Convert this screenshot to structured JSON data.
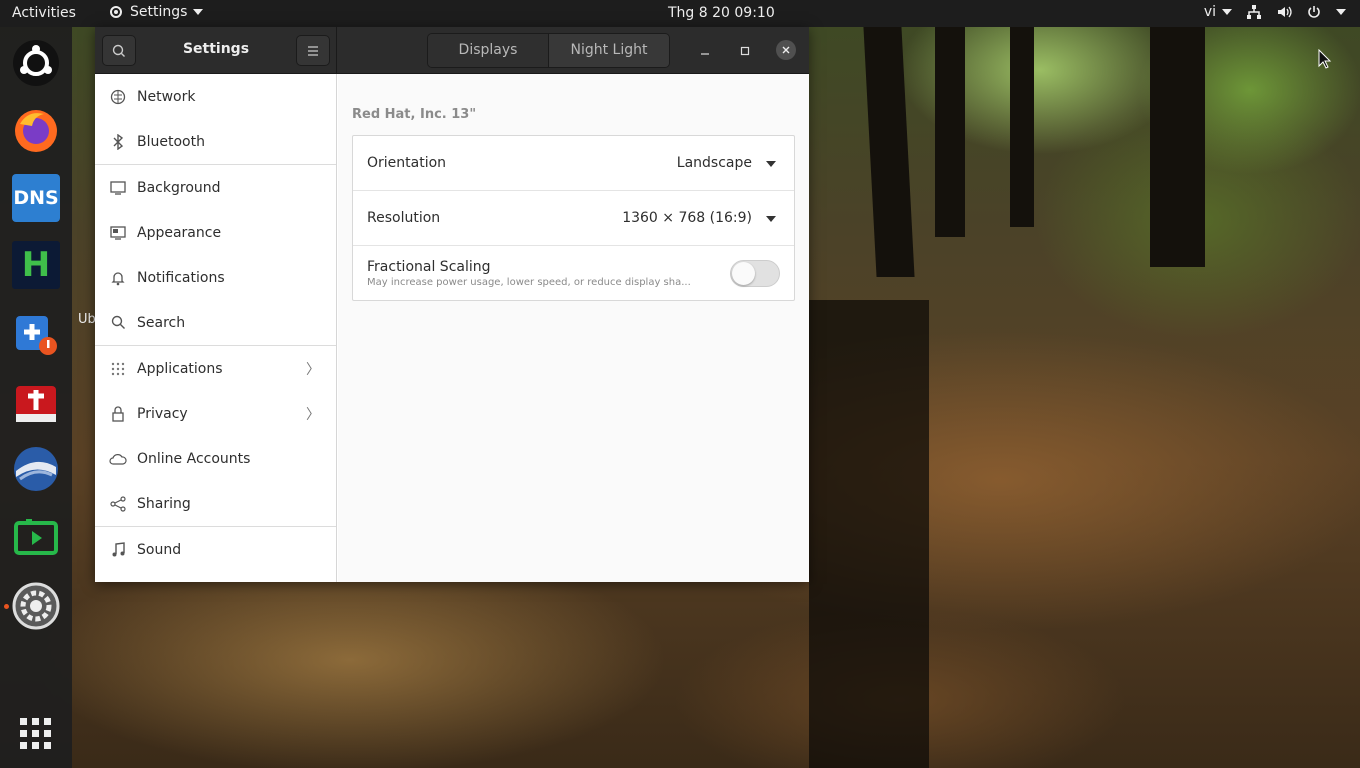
{
  "topbar": {
    "activities": "Activities",
    "app_menu": "Settings",
    "clock": "Thg 8 20  09:10",
    "input_method": "vi"
  },
  "dock": {
    "items": [
      {
        "name": "ubuntu-icon"
      },
      {
        "name": "firefox-icon"
      },
      {
        "name": "dns-icon",
        "text": "DNS"
      },
      {
        "name": "h-app-icon",
        "text": "H"
      },
      {
        "name": "software-updater-icon"
      },
      {
        "name": "app-installer-icon"
      },
      {
        "name": "thunderbird-icon"
      },
      {
        "name": "screen-recorder-icon"
      },
      {
        "name": "settings-icon"
      },
      {
        "name": "show-apps-icon"
      }
    ],
    "truncated_label": "Ub"
  },
  "window": {
    "title": "Settings",
    "tabs": [
      {
        "label": "Displays"
      },
      {
        "label": "Night Light"
      }
    ],
    "sidebar": {
      "items": [
        {
          "label": "Network",
          "icon": "network-icon"
        },
        {
          "label": "Bluetooth",
          "icon": "bluetooth-icon"
        },
        {
          "label": "Background",
          "icon": "background-icon"
        },
        {
          "label": "Appearance",
          "icon": "appearance-icon"
        },
        {
          "label": "Notifications",
          "icon": "bell-icon"
        },
        {
          "label": "Search",
          "icon": "search-icon"
        },
        {
          "label": "Applications",
          "icon": "apps-grid-icon"
        },
        {
          "label": "Privacy",
          "icon": "lock-icon"
        },
        {
          "label": "Online Accounts",
          "icon": "cloud-icon"
        },
        {
          "label": "Sharing",
          "icon": "share-icon"
        },
        {
          "label": "Sound",
          "icon": "music-note-icon"
        }
      ]
    },
    "display": {
      "monitor_name": "Red Hat, Inc. 13\"",
      "orientation_label": "Orientation",
      "orientation_value": "Landscape",
      "resolution_label": "Resolution",
      "resolution_value": "1360 × 768 (16:9)",
      "fractional_label": "Fractional Scaling",
      "fractional_desc": "May increase power usage, lower speed, or reduce display sha...",
      "fractional_enabled": false
    }
  },
  "colors": {
    "topbar": "#1d1d1d",
    "headerbar": "#2c2c2c",
    "accent": "#e95420"
  }
}
